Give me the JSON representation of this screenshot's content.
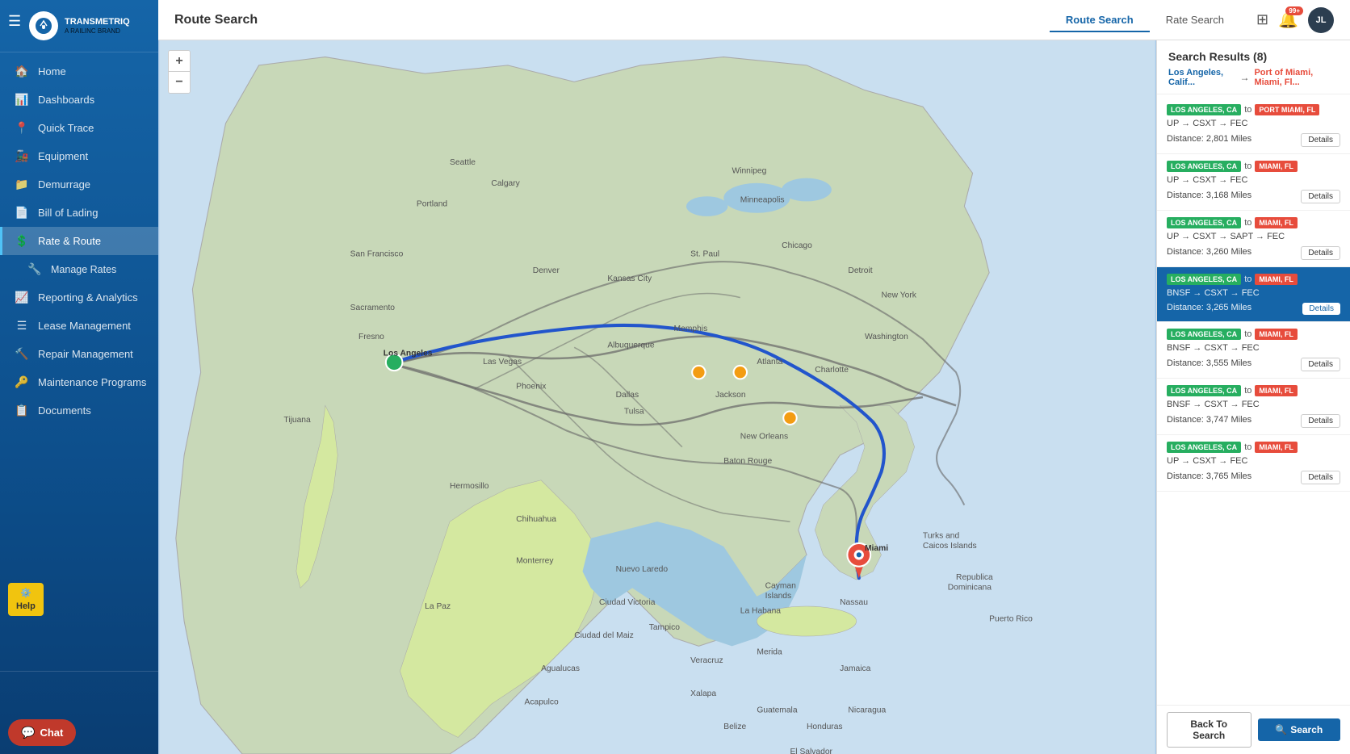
{
  "app": {
    "logo_text": "TRANSMETRIQ",
    "logo_sub": "A RAILINC BRAND"
  },
  "header": {
    "page_title": "Route Search",
    "tabs": [
      {
        "id": "route-search",
        "label": "Route Search",
        "active": true
      },
      {
        "id": "rate-search",
        "label": "Rate Search",
        "active": false
      }
    ],
    "notif_count": "99+",
    "avatar_initials": "JL"
  },
  "sidebar": {
    "nav_items": [
      {
        "id": "home",
        "label": "Home",
        "icon": "🏠",
        "active": false
      },
      {
        "id": "dashboards",
        "label": "Dashboards",
        "icon": "📊",
        "active": false
      },
      {
        "id": "quick-trace",
        "label": "Quick Trace",
        "icon": "📍",
        "active": false
      },
      {
        "id": "equipment",
        "label": "Equipment",
        "icon": "🚂",
        "active": false
      },
      {
        "id": "demurrage",
        "label": "Demurrage",
        "icon": "📁",
        "active": false
      },
      {
        "id": "bill-of-lading",
        "label": "Bill of Lading",
        "icon": "📄",
        "active": false
      },
      {
        "id": "rate-route",
        "label": "Rate & Route",
        "icon": "💲",
        "active": true
      },
      {
        "id": "manage-rates",
        "label": "Manage Rates",
        "icon": "🔧",
        "active": false,
        "sub": true
      },
      {
        "id": "reporting",
        "label": "Reporting & Analytics",
        "icon": "📈",
        "active": false
      },
      {
        "id": "lease-mgmt",
        "label": "Lease Management",
        "icon": "☰",
        "active": false
      },
      {
        "id": "repair-mgmt",
        "label": "Repair Management",
        "icon": "🔨",
        "active": false
      },
      {
        "id": "maintenance",
        "label": "Maintenance Programs",
        "icon": "🔑",
        "active": false
      },
      {
        "id": "documents",
        "label": "Documents",
        "icon": "📋",
        "active": false
      }
    ],
    "chat_label": "Chat",
    "help_label": "Help"
  },
  "results": {
    "title": "Search Results (8)",
    "from_label": "Los Angeles, Calif...",
    "to_label": "Port of Miami, Miami, Fl...",
    "cards": [
      {
        "from": "LOS ANGELES, CA",
        "to": "PORT MIAMI, FL",
        "route": "UP → CSXT → FEC",
        "distance": "Distance: 2,801 Miles",
        "selected": false
      },
      {
        "from": "LOS ANGELES, CA",
        "to": "MIAMI, FL",
        "route": "UP → CSXT → FEC",
        "distance": "Distance: 3,168 Miles",
        "selected": false
      },
      {
        "from": "LOS ANGELES, CA",
        "to": "MIAMI, FL",
        "route": "UP → CSXT → SAPT → FEC",
        "distance": "Distance: 3,260 Miles",
        "selected": false
      },
      {
        "from": "LOS ANGELES, CA",
        "to": "MIAMI, FL",
        "route": "BNSF → CSXT → FEC",
        "distance": "Distance: 3,265 Miles",
        "selected": true
      },
      {
        "from": "LOS ANGELES, CA",
        "to": "MIAMI, FL",
        "route": "BNSF → CSXT → FEC",
        "distance": "Distance: 3,555 Miles",
        "selected": false
      },
      {
        "from": "LOS ANGELES, CA",
        "to": "MIAMI, FL",
        "route": "BNSF → CSXT → FEC",
        "distance": "Distance: 3,747 Miles",
        "selected": false
      },
      {
        "from": "LOS ANGELES, CA",
        "to": "MIAMI, FL",
        "route": "UP → CSXT → FEC",
        "distance": "Distance: 3,765 Miles",
        "selected": false
      }
    ],
    "back_btn_label": "Back To Search",
    "search_btn_label": "Search"
  },
  "map": {
    "zoom_in": "+",
    "zoom_out": "−"
  }
}
